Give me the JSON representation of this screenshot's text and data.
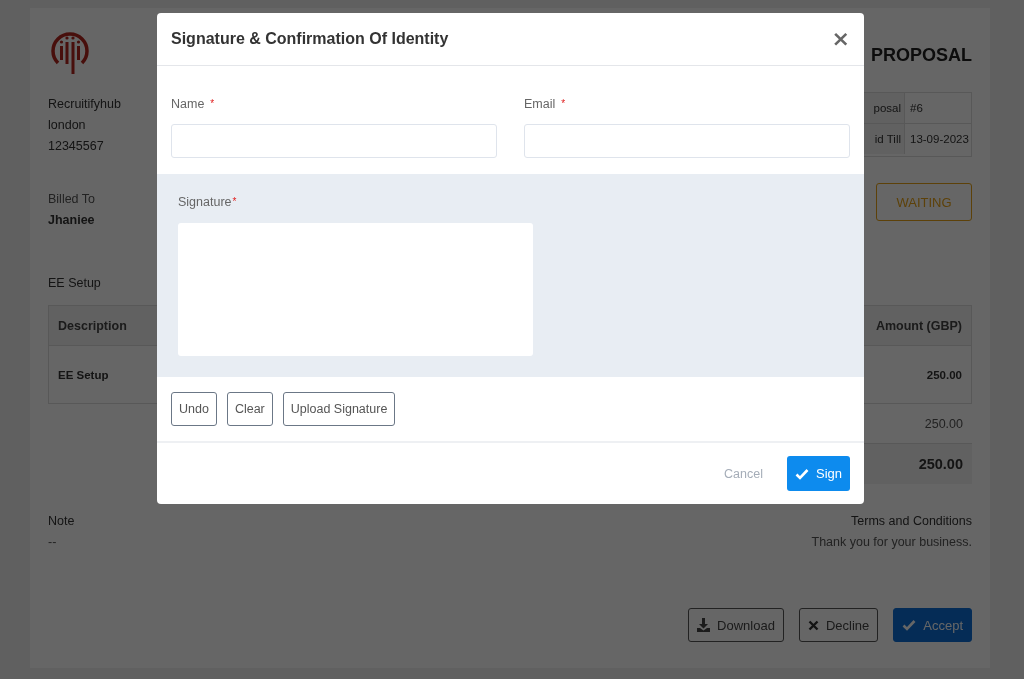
{
  "page": {
    "title": "PROPOSAL",
    "company": [
      "Recruitifyhub",
      "london",
      "12345567"
    ],
    "info": [
      {
        "label": "posal",
        "value": "#6"
      },
      {
        "label": "id Till",
        "value": "13-09-2023"
      }
    ],
    "billed_to": {
      "label": "Billed To",
      "name": "Jhaniee"
    },
    "status": "WAITING",
    "section_title": "EE Setup",
    "table": {
      "columns": [
        "Description",
        "Amount (GBP)"
      ],
      "rows": [
        [
          "EE Setup",
          "250.00"
        ]
      ]
    },
    "subtotal": "250.00",
    "total": "250.00",
    "note": {
      "label": "Note",
      "text": "--"
    },
    "terms": {
      "label": "Terms and Conditions",
      "text": "Thank you for your business."
    },
    "actions": [
      {
        "label": "Download",
        "kind": "download"
      },
      {
        "label": "Decline",
        "kind": "decline"
      },
      {
        "label": "Accept",
        "kind": "accept"
      }
    ]
  },
  "dialog": {
    "title": "Signature & Confirmation Of Identity",
    "close": "×",
    "fields": [
      {
        "label": "Name",
        "mark": "*"
      },
      {
        "label": "Email",
        "mark": "*"
      }
    ],
    "signature": {
      "label": "Signature",
      "mark": "*"
    },
    "pad_buttons": [
      "Undo",
      "Clear",
      "Upload Signature"
    ],
    "cancel": "Cancel",
    "confirm": "Sign"
  }
}
